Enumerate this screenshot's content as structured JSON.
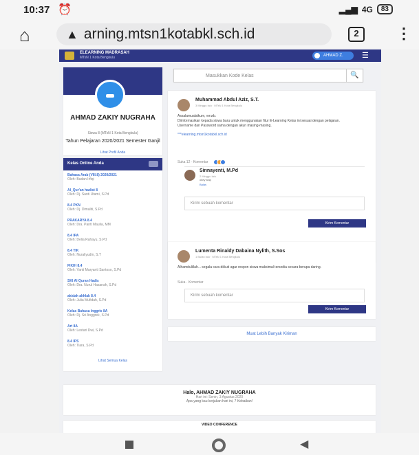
{
  "status": {
    "time": "10:37",
    "signal": "4G",
    "battery": "83"
  },
  "browser": {
    "url": "arning.mtsn1kotabkl.sch.id",
    "tab_count": "2"
  },
  "site": {
    "brand": "ELEARNING MADRASAH",
    "brand_sub": "MTsN 1 Kota Bengkulu",
    "user_btn": "AHMAD Z.",
    "colors": {
      "primary": "#2e3785",
      "accent": "#3e7ee0"
    }
  },
  "profile": {
    "name": "AHMAD ZAKIY NUGRAHA",
    "class": "Siswa 8 (MTsN 1 Kota Bengkulu)",
    "year": "Tahun Pelajaran 2020/2021 Semester Ganjil",
    "link": "Lihat Profil Anda"
  },
  "classes": {
    "title": "Kelas Online Anda",
    "items": [
      {
        "t": "Bahasa Arab (VIII.8) 2020/2021",
        "g": "Oleh: Badan Irfiqi"
      },
      {
        "t": "Al_Qur'an hadist 8",
        "g": "Oleh: Dj. Santi Utami, S.Pd"
      },
      {
        "t": "8.4 PKN",
        "g": "Oleh: Dj. Dimaliti, S.Pd"
      },
      {
        "t": "PRAKARYA 8.4",
        "g": "Oleh: Dra. Panti Maulia, MM"
      },
      {
        "t": "8.4 IPA",
        "g": "Oleh: Delia Rahayu, S.Pd"
      },
      {
        "t": "8.4 TIK",
        "g": "Oleh: Nuraliyudin, S.T"
      },
      {
        "t": "FIKIH 8.4",
        "g": "Oleh: Yanti Maryanti Santoso, S.Pd"
      },
      {
        "t": "SKI Al Quran Hadis",
        "g": "Oleh: Dra. Nurul Hasanah, S.Pd"
      },
      {
        "t": "akidah akhlak 8.4",
        "g": "Oleh: Julia Mufidah, S.Pd"
      },
      {
        "t": "Kelas Bahasa Inggris 8A",
        "g": "Oleh: Dj. Sri Anggrek, S.Pd"
      },
      {
        "t": "Art 8A",
        "g": "Oleh: Lestari Dwi, S.Pd"
      },
      {
        "t": "8.4 IPS",
        "g": "Oleh: Tiara, S.Pd"
      }
    ],
    "more": "Lihat Semua Kelas"
  },
  "search": {
    "placeholder": "Masukkan Kode Kelas"
  },
  "post1": {
    "author": "Muhammad Abdul Aziz, S.T.",
    "meta": "3 Minggu lalu · MTsN 1 Kota Bengkulu",
    "body1": "Assalamualaikum, wr.wb.",
    "body2": "Diinformasikan kepada siswa baru untuk menggunakan fitur E-Learning Kelas ini sesuai dengan pelajaran.",
    "body3": "Username dan Password sama dengan akun masing-masing.",
    "link": "***elearning.mtsn1kotabkl.sch.id",
    "actions": "Suka 12 · Komentar"
  },
  "reply": {
    "name": "Sinnayenti, M.Pd",
    "meta": "2 Minggu lalu",
    "text": "okey siap",
    "btn": "Balas"
  },
  "comment": {
    "placeholder": "Kirim sebuah komentar",
    "send": "Kirim Komentar"
  },
  "post2": {
    "author": "Lumenta Rinaldy Dabaina Nylith, S.Sos",
    "meta": "1 Bulan lalu · MTsN 1 Kota Bengkulu",
    "body": "Alhamdulillah... segala cara diikuti agar respon siswa maksimal tersedia secara berupa daring.",
    "actions": "Suka · Komentar"
  },
  "load_more": "Muat Lebih Banyak Kiriman",
  "footer": {
    "hello": "Halo, AHMAD ZAKIY NUGRAHA",
    "date": "Hari ini: Senin, 3 Agustus 2020",
    "quote": "Apa yang kau kerjakan hari ini, 7 Kebaikan!"
  },
  "video_conf": "VIDEO CONFERENCE"
}
